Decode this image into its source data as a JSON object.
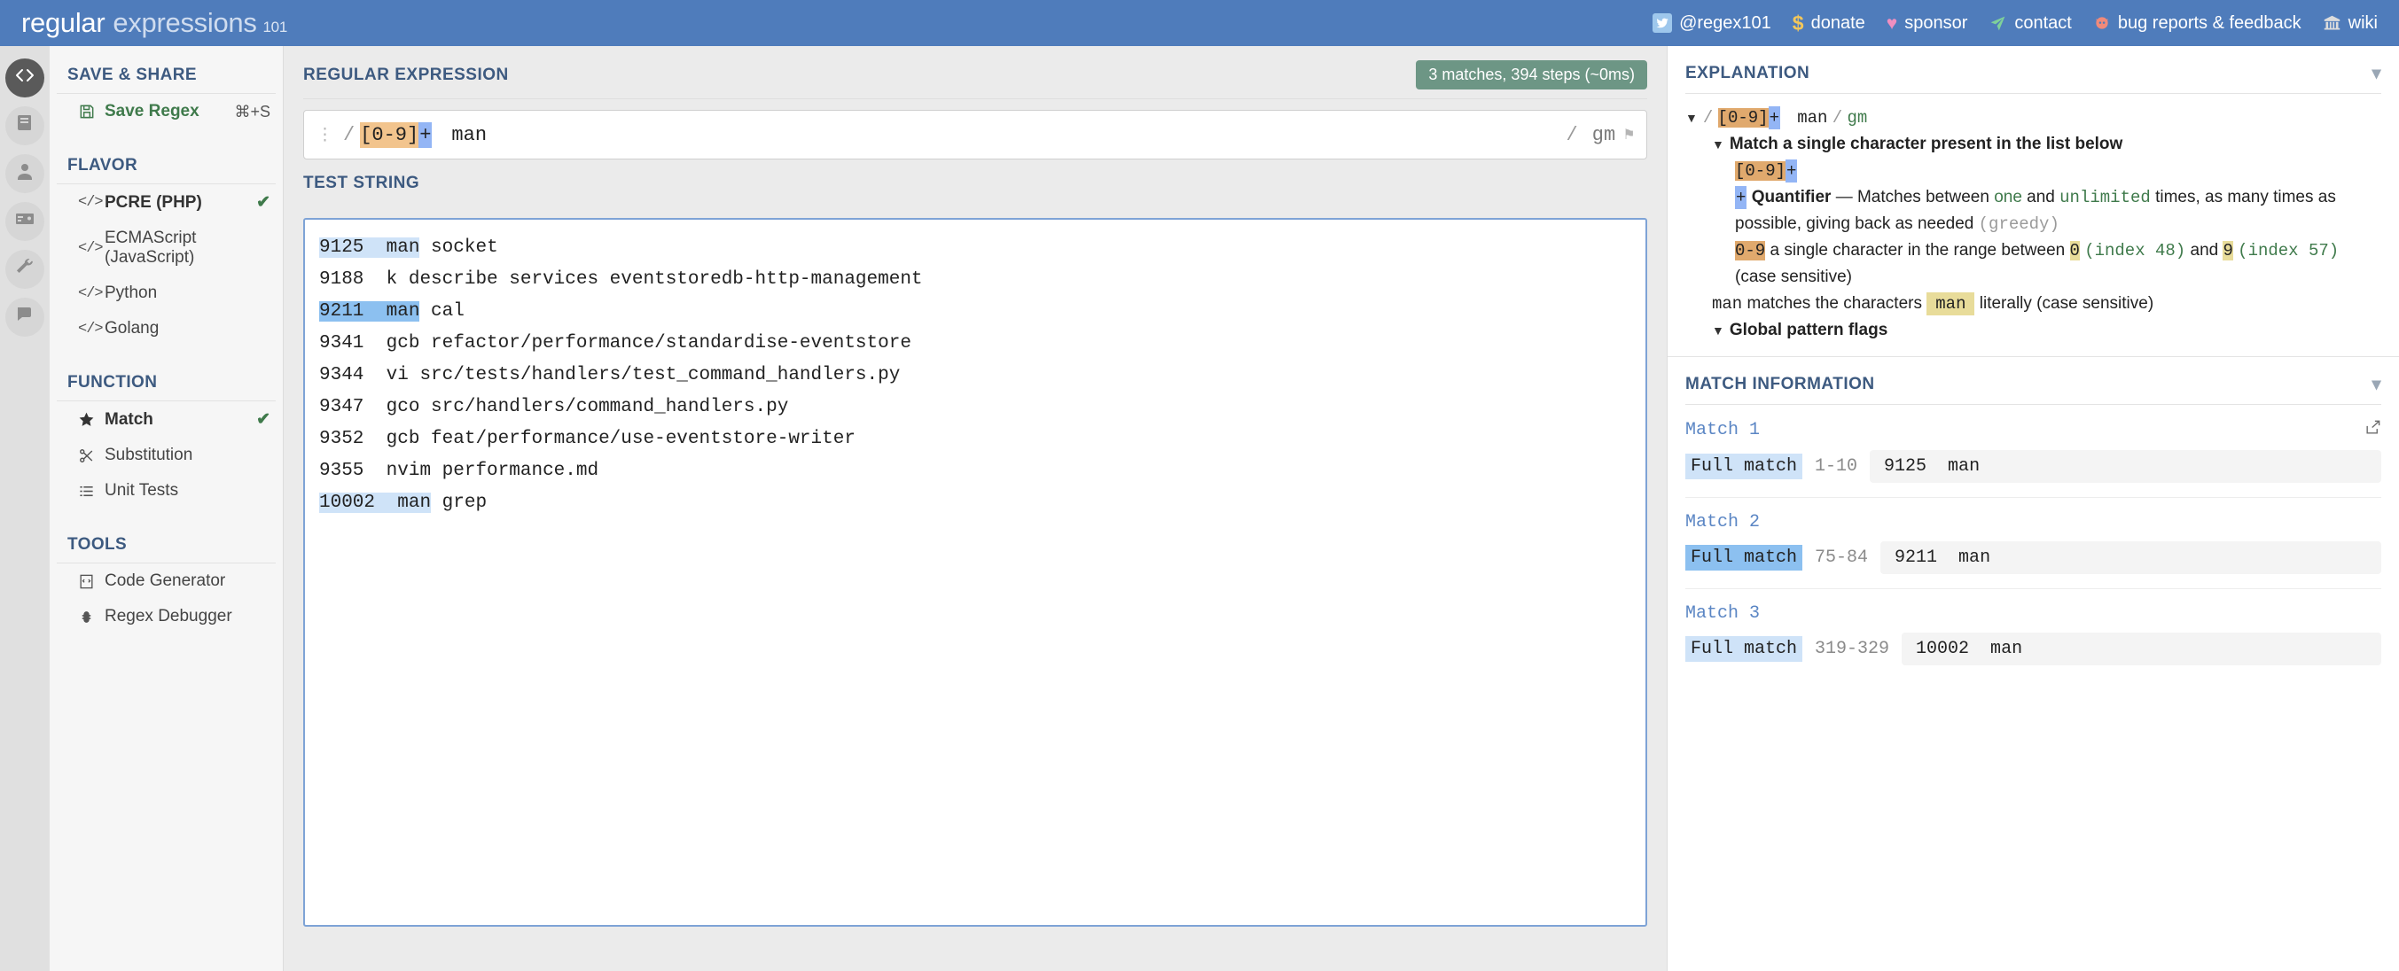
{
  "brand": {
    "part1": "regular",
    "part2": "expressions",
    "part3": "101"
  },
  "topnav": [
    {
      "icon": "twitter-icon",
      "glyph": "ᵗ",
      "label": "@regex101"
    },
    {
      "icon": "dollar-icon",
      "glyph": "$",
      "label": "donate"
    },
    {
      "icon": "heart-icon",
      "glyph": "♥",
      "label": "sponsor"
    },
    {
      "icon": "paper-plane-icon",
      "glyph": "➤",
      "label": "contact"
    },
    {
      "icon": "bug-icon",
      "glyph": "",
      "label": "bug reports & feedback"
    },
    {
      "icon": "bank-icon",
      "glyph": "🏛",
      "label": "wiki"
    }
  ],
  "rail": [
    {
      "name": "code-icon",
      "active": true
    },
    {
      "name": "library-book-icon",
      "active": false
    },
    {
      "name": "account-icon",
      "active": false
    },
    {
      "name": "sponsor-card-icon",
      "active": false
    },
    {
      "name": "settings-wrench-icon",
      "active": false
    },
    {
      "name": "chat-comments-icon",
      "active": false
    }
  ],
  "sidebar": {
    "save_share": {
      "heading": "SAVE & SHARE",
      "item": {
        "label": "Save Regex",
        "shortcut": "⌘+S",
        "icon": "floppy-disk-icon"
      }
    },
    "flavor": {
      "heading": "FLAVOR",
      "items": [
        {
          "label": "PCRE (PHP)",
          "selected": true
        },
        {
          "label": "ECMAScript (JavaScript)",
          "selected": false
        },
        {
          "label": "Python",
          "selected": false
        },
        {
          "label": "Golang",
          "selected": false
        }
      ]
    },
    "function": {
      "heading": "FUNCTION",
      "items": [
        {
          "label": "Match",
          "icon": "star-icon",
          "selected": true
        },
        {
          "label": "Substitution",
          "icon": "scissors-icon",
          "selected": false
        },
        {
          "label": "Unit Tests",
          "icon": "list-icon",
          "selected": false
        }
      ]
    },
    "tools": {
      "heading": "TOOLS",
      "items": [
        {
          "label": "Code Generator",
          "icon": "code-generator-icon"
        },
        {
          "label": "Regex Debugger",
          "icon": "debugger-bug-icon"
        }
      ]
    },
    "check_glyph": "✔"
  },
  "regex_section": {
    "title": "REGULAR EXPRESSION",
    "badge": "3 matches, 394 steps (~0ms)",
    "delimiter": "/",
    "pattern_class": "[0-9]",
    "pattern_quantifier": "+",
    "pattern_literal": "man",
    "flags": "gm",
    "flag_icon": "flag-icon"
  },
  "test_section": {
    "title": "TEST STRING",
    "lines": [
      {
        "num": "9125",
        "gap": "  ",
        "match": "man",
        "rest": " socket",
        "highlight": "light"
      },
      {
        "num": "9188",
        "gap": "  ",
        "match": "",
        "rest": "k describe services eventstoredb-http-management",
        "highlight": "none"
      },
      {
        "num": "9211",
        "gap": "  ",
        "match": "man",
        "rest": " cal",
        "highlight": "dark"
      },
      {
        "num": "9341",
        "gap": "  ",
        "match": "",
        "rest": "gcb refactor/performance/standardise-eventstore",
        "highlight": "none"
      },
      {
        "num": "9344",
        "gap": "  ",
        "match": "",
        "rest": "vi src/tests/handlers/test_command_handlers.py",
        "highlight": "none"
      },
      {
        "num": "9347",
        "gap": "  ",
        "match": "",
        "rest": "gco src/handlers/command_handlers.py",
        "highlight": "none"
      },
      {
        "num": "9352",
        "gap": "  ",
        "match": "",
        "rest": "gcb feat/performance/use-eventstore-writer",
        "highlight": "none"
      },
      {
        "num": "9355",
        "gap": "  ",
        "match": "",
        "rest": "nvim performance.md",
        "highlight": "none"
      },
      {
        "num": "10002",
        "gap": "  ",
        "match": "man",
        "rest": " grep",
        "highlight": "light"
      }
    ]
  },
  "explanation": {
    "heading": "EXPLANATION",
    "pattern_line": {
      "slash": "/",
      "cls": "[0-9]",
      "quant": "+",
      "literal": "man",
      "flags": "gm"
    },
    "node_title": "Match a single character present in the list below",
    "node_token": "[0-9]",
    "node_token_quant": "+",
    "quantifier": {
      "symbol": "+",
      "name": "Quantifier",
      "dash": "—",
      "text_a": "Matches between",
      "one": "one",
      "text_b": "and",
      "unlimited": "unlimited",
      "text_c": "times, as many times as possible, giving back as needed",
      "greedy": "(greedy)"
    },
    "range": {
      "token": "0-9",
      "text_a": "a single character in the range between",
      "low": "0",
      "low_index": "(index 48)",
      "text_b": "and",
      "high": "9",
      "high_index": "(index 57)",
      "case": "(case sensitive)"
    },
    "literal": {
      "token": "man",
      "text_a": "matches the characters",
      "token2": "man",
      "text_b": "literally (case sensitive)"
    },
    "global_flags": "Global pattern flags"
  },
  "match_information": {
    "heading": "MATCH INFORMATION",
    "share_icon": "share-icon",
    "matches": [
      {
        "title": "Match 1",
        "tag": "Full match",
        "tag_style": "light",
        "range": "1-10",
        "value": "9125  man",
        "has_share": true
      },
      {
        "title": "Match 2",
        "tag": "Full match",
        "tag_style": "dark",
        "range": "75-84",
        "value": "9211  man",
        "has_share": false
      },
      {
        "title": "Match 3",
        "tag": "Full match",
        "tag_style": "light",
        "range": "319-329",
        "value": "10002  man",
        "has_share": false
      }
    ]
  }
}
